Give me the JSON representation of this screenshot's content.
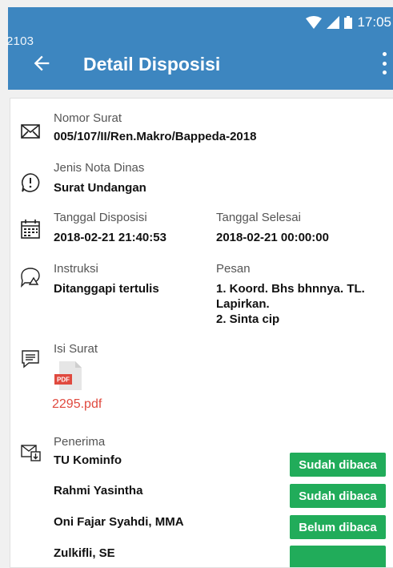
{
  "status_bar": {
    "time": "17:05"
  },
  "debug_text": "2103",
  "app_bar": {
    "title": "Detail Disposisi"
  },
  "fields": {
    "nomor_surat": {
      "label": "Nomor Surat",
      "value": "005/107/II/Ren.Makro/Bappeda-2018"
    },
    "jenis_nota": {
      "label": "Jenis Nota Dinas",
      "value": "Surat Undangan"
    },
    "tanggal_disposisi": {
      "label": "Tanggal Disposisi",
      "value": "2018-02-21 21:40:53"
    },
    "tanggal_selesai": {
      "label": "Tanggal Selesai",
      "value": "2018-02-21 00:00:00"
    },
    "instruksi": {
      "label": "Instruksi",
      "value": "Ditanggapi tertulis"
    },
    "pesan": {
      "label": "Pesan",
      "lines": [
        "1. Koord. Bhs bhnnya. TL.",
        "Lapirkan.",
        "2. Sinta cip"
      ]
    },
    "isi_surat": {
      "label": "Isi Surat",
      "file_badge": "PDF",
      "file_name": "2295.pdf"
    },
    "penerima": {
      "label": "Penerima",
      "recipients": [
        {
          "name": "TU Kominfo",
          "status": "Sudah dibaca"
        },
        {
          "name": "Rahmi Yasintha",
          "status": "Sudah dibaca"
        },
        {
          "name": "Oni Fajar Syahdi, MMA",
          "status": "Belum dibaca"
        },
        {
          "name": "Zulkifli, SE",
          "status": ""
        }
      ]
    }
  },
  "colors": {
    "app_bar": "#3d86c0",
    "badge": "#21ac5a",
    "file_link": "#e04a3f"
  }
}
